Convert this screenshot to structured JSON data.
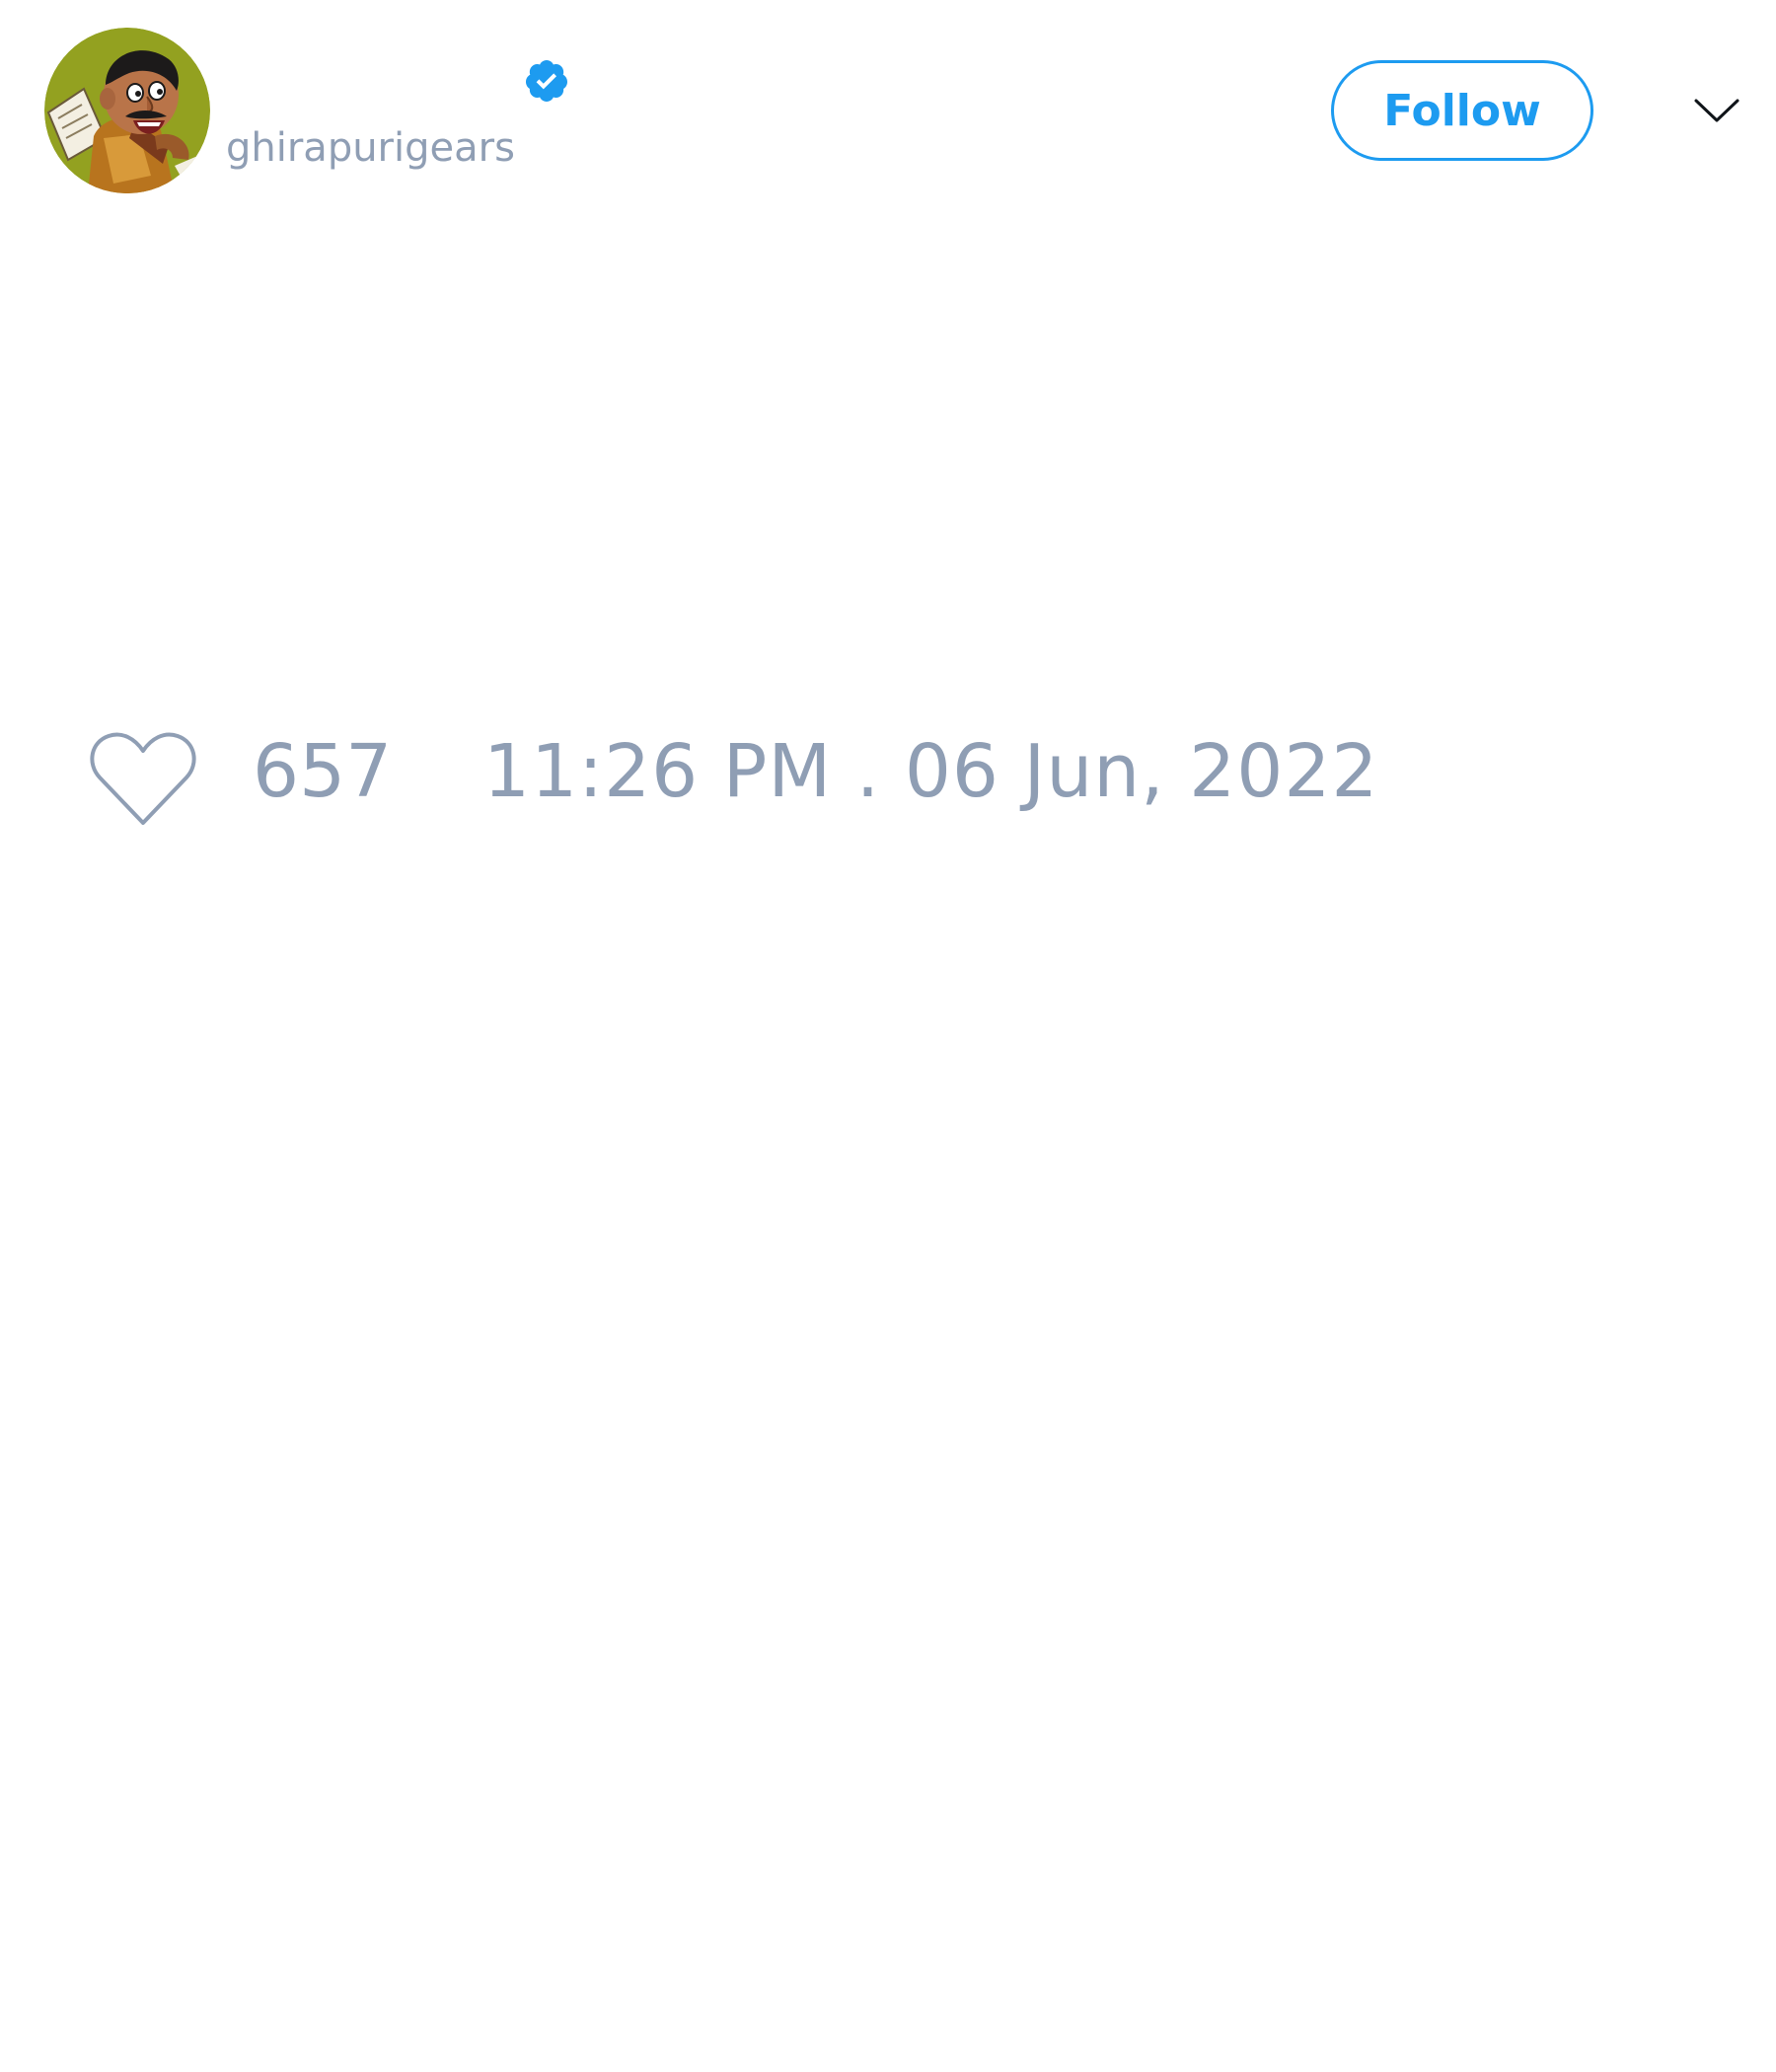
{
  "author": {
    "display_name": "",
    "handle": "ghirapurigears",
    "verified": true,
    "avatar_icon": "cartoon-character-avatar",
    "verified_icon": "verified-badge-icon"
  },
  "actions": {
    "follow_label": "Follow",
    "menu_icon": "chevron-down-icon"
  },
  "stats": {
    "like_icon": "heart-outline-icon",
    "like_count": "657",
    "timestamp": "11:26 PM . 06 Jun, 2022"
  },
  "colors": {
    "accent": "#1d9bf0",
    "muted_text": "#8f9eb4",
    "background": "#ffffff",
    "avatar_background": "#8a9a1e"
  }
}
